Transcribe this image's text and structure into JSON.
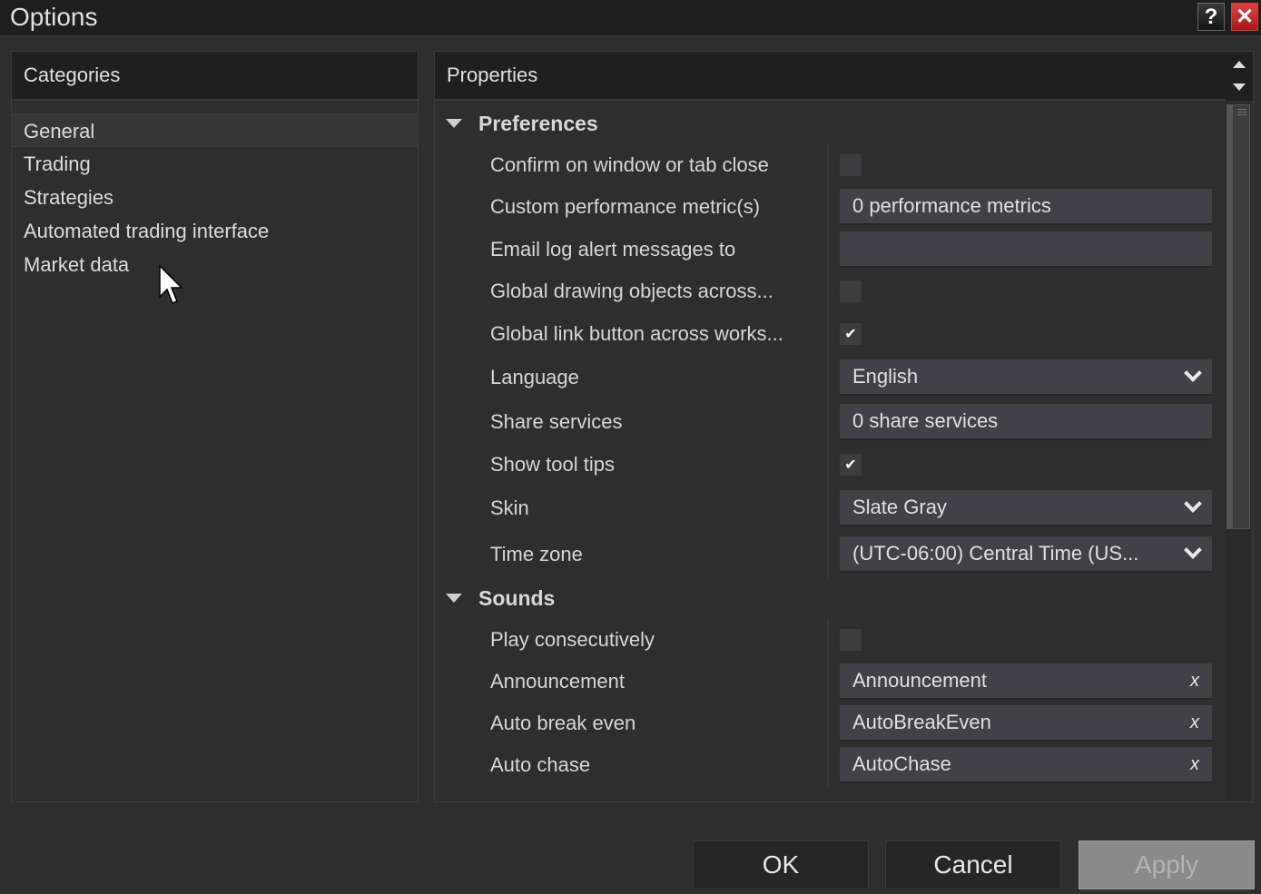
{
  "window": {
    "title": "Options",
    "help_label": "?",
    "close_label": "✕"
  },
  "categories": {
    "header": "Categories",
    "items": [
      {
        "label": "General",
        "selected": true
      },
      {
        "label": "Trading",
        "selected": false
      },
      {
        "label": "Strategies",
        "selected": false
      },
      {
        "label": "Automated trading interface",
        "selected": false
      },
      {
        "label": "Market data",
        "selected": false
      }
    ]
  },
  "properties": {
    "header": "Properties",
    "sections": [
      {
        "title": "Preferences",
        "expanded": true,
        "rows": [
          {
            "label": "Confirm on window or tab close",
            "type": "checkbox",
            "checked": false
          },
          {
            "label": "Custom performance metric(s)",
            "type": "text",
            "value": "0 performance metrics"
          },
          {
            "label": "Email log alert messages to",
            "type": "text",
            "value": ""
          },
          {
            "label": "Global drawing objects across...",
            "type": "checkbox",
            "checked": false
          },
          {
            "label": "Global link button across works...",
            "type": "checkbox",
            "checked": true
          },
          {
            "label": "Language",
            "type": "dropdown",
            "value": "English"
          },
          {
            "label": "Share services",
            "type": "text",
            "value": "0 share services"
          },
          {
            "label": "Show tool tips",
            "type": "checkbox",
            "checked": true
          },
          {
            "label": "Skin",
            "type": "dropdown",
            "value": "Slate Gray"
          },
          {
            "label": "Time zone",
            "type": "dropdown",
            "value": "(UTC-06:00) Central Time (US..."
          }
        ]
      },
      {
        "title": "Sounds",
        "expanded": true,
        "rows": [
          {
            "label": "Play consecutively",
            "type": "checkbox",
            "checked": false
          },
          {
            "label": "Announcement",
            "type": "sound",
            "value": "Announcement"
          },
          {
            "label": "Auto break even",
            "type": "sound",
            "value": "AutoBreakEven"
          },
          {
            "label": "Auto chase",
            "type": "sound",
            "value": "AutoChase"
          }
        ]
      }
    ],
    "clear_label": "x",
    "check_mark": "✔"
  },
  "footer": {
    "ok_label": "OK",
    "cancel_label": "Cancel",
    "apply_label": "Apply",
    "apply_enabled": false
  }
}
